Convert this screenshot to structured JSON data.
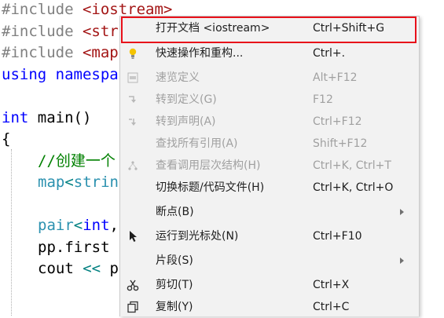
{
  "code": {
    "line1": {
      "pp": "#include ",
      "inc": "<iostream>"
    },
    "line2": {
      "pp": "#include ",
      "inc": "<str"
    },
    "line3": {
      "pp": "#include ",
      "inc": "<map"
    },
    "line4": {
      "kw": "using",
      "rest": " namespa"
    },
    "line6": {
      "kw": "int",
      "rest": " main()"
    },
    "line7": {
      "text": "{"
    },
    "line8": {
      "comment": "//创建一个"
    },
    "line9": {
      "type": "map",
      "op": "<",
      "type2": "strin"
    },
    "line11": {
      "type": "pair",
      "op": "<",
      "kw": "int",
      "rest": ","
    },
    "line12": {
      "text": "pp.first"
    },
    "line13": {
      "text": "cout ",
      "op": "<<",
      "rest": " p"
    }
  },
  "menu": {
    "items": [
      {
        "label": "打开文档 <iostream>",
        "shortcut": "Ctrl+Shift+G",
        "icon": "none",
        "disabled": false
      },
      {
        "label": "快速操作和重构...",
        "shortcut": "Ctrl+.",
        "icon": "lightbulb-icon",
        "disabled": false
      },
      {
        "label": "速览定义",
        "shortcut": "Alt+F12",
        "icon": "peek-definition-icon",
        "disabled": true
      },
      {
        "label": "转到定义(G)",
        "shortcut": "F12",
        "icon": "go-to-definition-icon",
        "disabled": true
      },
      {
        "label": "转到声明(A)",
        "shortcut": "Ctrl+F12",
        "icon": "go-to-declaration-icon",
        "disabled": true
      },
      {
        "label": "查找所有引用(A)",
        "shortcut": "Shift+F12",
        "icon": "none",
        "disabled": true
      },
      {
        "label": "查看调用层次结构(H)",
        "shortcut": "Ctrl+K, Ctrl+T",
        "icon": "call-hierarchy-icon",
        "disabled": true
      },
      {
        "label": "切换标题/代码文件(H)",
        "shortcut": "Ctrl+K, Ctrl+O",
        "icon": "none",
        "disabled": false
      },
      {
        "label": "断点(B)",
        "shortcut": "",
        "icon": "none",
        "disabled": false,
        "submenu": true
      },
      {
        "label": "运行到光标处(N)",
        "shortcut": "Ctrl+F10",
        "icon": "run-to-cursor-icon",
        "disabled": false
      },
      {
        "label": "片段(S)",
        "shortcut": "",
        "icon": "none",
        "disabled": false,
        "submenu": true
      },
      {
        "label": "剪切(T)",
        "shortcut": "Ctrl+X",
        "icon": "scissors-icon",
        "disabled": false
      },
      {
        "label": "复制(Y)",
        "shortcut": "Ctrl+C",
        "icon": "copy-icon",
        "disabled": false
      }
    ]
  },
  "colors": {
    "highlight_border": "#e8101a",
    "keyword": "#0000ff",
    "type": "#2b91af",
    "comment": "#008000",
    "include_string": "#a31515",
    "preprocessor": "#808080"
  }
}
